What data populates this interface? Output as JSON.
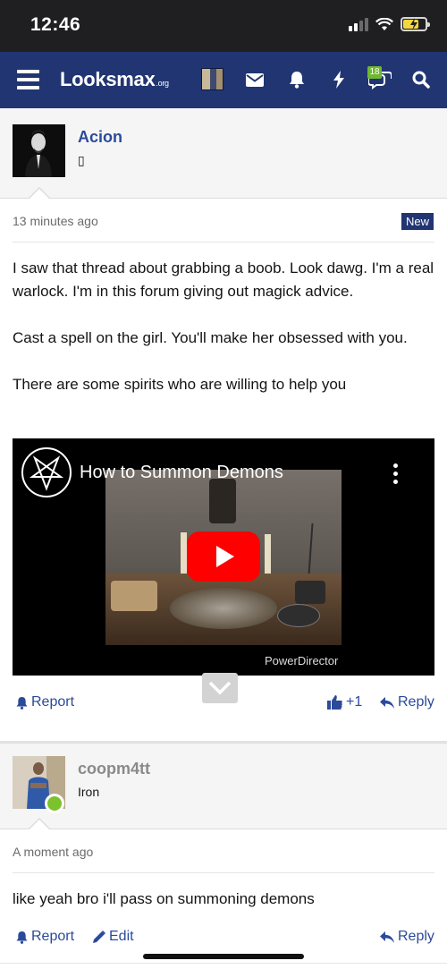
{
  "status_bar": {
    "time": "12:46",
    "colors": {
      "background": "#1f1f21",
      "battery": "#f3d83b"
    }
  },
  "navbar": {
    "logo_text": "Looksmax",
    "logo_suffix": ".org",
    "conversations_badge": "18",
    "colors": {
      "background": "#213572",
      "badge": "#6fb731"
    },
    "icons": [
      "menu-icon",
      "avatar",
      "envelope-icon",
      "bell-icon",
      "bolt-icon",
      "chat-bubbles-icon",
      "search-icon"
    ]
  },
  "posts": [
    {
      "username": "Acion",
      "user_title": "▯",
      "username_color": "#2b4a9a",
      "time": "13 minutes ago",
      "badge": "New",
      "body": [
        "I saw that thread about grabbing a boob. Look dawg. I'm a real warlock. I'm in this forum giving out magick advice.",
        "Cast a spell on the girl. You'll make her obsessed with you.",
        "There are some spirits who are willing to help you"
      ],
      "video": {
        "title": "How to Summon Demons",
        "watermark": "PowerDirector",
        "icons": [
          "pentagram-icon",
          "kebab-menu-icon",
          "play-icon"
        ]
      },
      "actions": {
        "report": "Report",
        "reaction_count": "+1",
        "reply": "Reply"
      }
    },
    {
      "username": "coopm4tt",
      "user_title": "Iron",
      "username_color": "#8a8a8a",
      "online": true,
      "time": "A moment ago",
      "body": [
        "like yeah bro i'll pass on summoning demons"
      ],
      "actions": {
        "report": "Report",
        "edit": "Edit",
        "reply": "Reply"
      }
    }
  ]
}
